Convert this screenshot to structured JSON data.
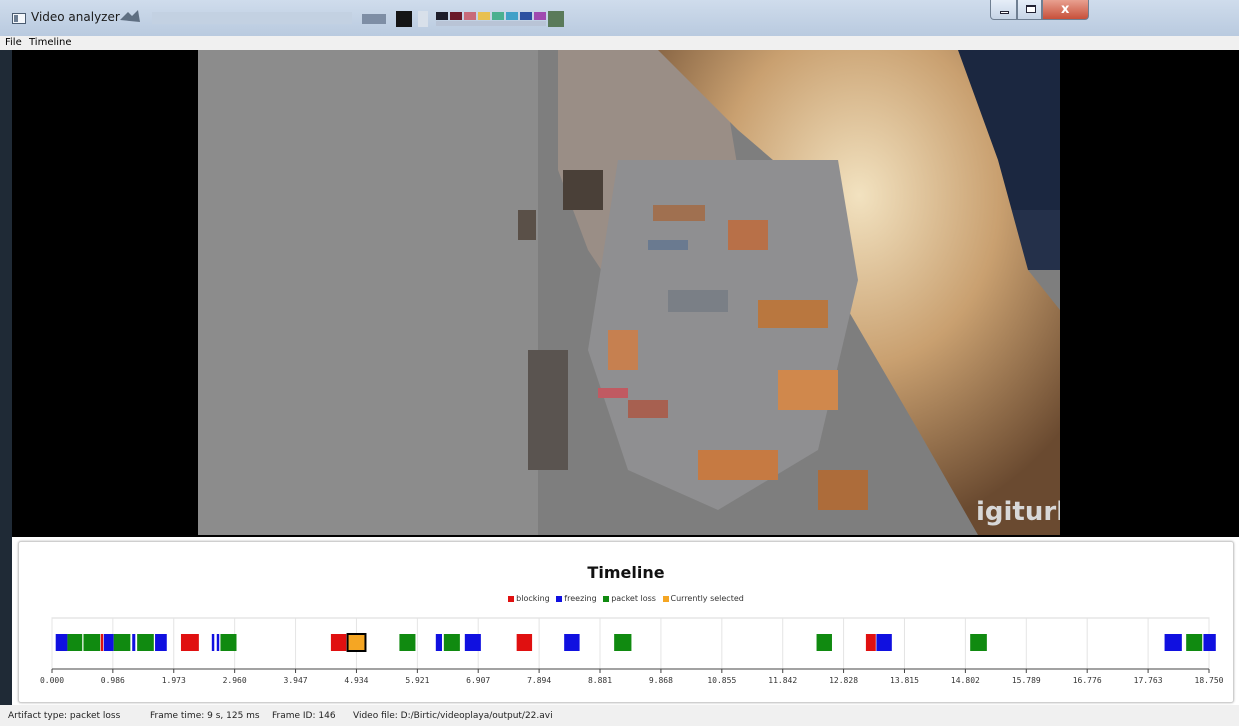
{
  "window": {
    "title": "Video analyzer",
    "buttons": {
      "minimize": "minimize",
      "maximize": "maximize",
      "close": "x"
    }
  },
  "menu": {
    "items": [
      "File",
      "Timeline"
    ]
  },
  "video": {
    "watermark": "igiturk"
  },
  "timeline": {
    "title": "Timeline",
    "legend": [
      {
        "label": "blocking",
        "color": "#e01010"
      },
      {
        "label": "freezing",
        "color": "#1010e0"
      },
      {
        "label": "packet loss",
        "color": "#108a10"
      },
      {
        "label": "Currently selected",
        "color": "#f5a623"
      }
    ],
    "axis": {
      "min": 0,
      "max": 18.75,
      "ticks": [
        "0.000",
        "0.986",
        "1.973",
        "2.960",
        "3.947",
        "4.934",
        "5.921",
        "6.907",
        "7.894",
        "8.881",
        "9.868",
        "10.855",
        "11.842",
        "12.828",
        "13.815",
        "14.802",
        "15.789",
        "16.776",
        "17.763",
        "18.750"
      ]
    },
    "markers": [
      {
        "type": "freezing",
        "start": 0.06,
        "end": 0.25
      },
      {
        "type": "packet loss",
        "start": 0.25,
        "end": 0.49
      },
      {
        "type": "packet loss",
        "start": 0.51,
        "end": 0.78
      },
      {
        "type": "blocking",
        "start": 0.79,
        "end": 0.83
      },
      {
        "type": "freezing",
        "start": 0.84,
        "end": 1.0
      },
      {
        "type": "packet loss",
        "start": 1.0,
        "end": 1.27
      },
      {
        "type": "freezing",
        "start": 1.3,
        "end": 1.35
      },
      {
        "type": "packet loss",
        "start": 1.38,
        "end": 1.65
      },
      {
        "type": "freezing",
        "start": 1.67,
        "end": 1.86
      },
      {
        "type": "blocking",
        "start": 2.09,
        "end": 2.38
      },
      {
        "type": "freezing",
        "start": 2.59,
        "end": 2.63
      },
      {
        "type": "freezing",
        "start": 2.67,
        "end": 2.71
      },
      {
        "type": "packet loss",
        "start": 2.73,
        "end": 2.99
      },
      {
        "type": "blocking",
        "start": 4.52,
        "end": 4.77
      },
      {
        "type": "selected",
        "start": 4.79,
        "end": 5.08
      },
      {
        "type": "packet loss",
        "start": 5.63,
        "end": 5.89
      },
      {
        "type": "freezing",
        "start": 6.22,
        "end": 6.32
      },
      {
        "type": "packet loss",
        "start": 6.35,
        "end": 6.61
      },
      {
        "type": "freezing",
        "start": 6.69,
        "end": 6.95
      },
      {
        "type": "blocking",
        "start": 7.53,
        "end": 7.78
      },
      {
        "type": "freezing",
        "start": 8.3,
        "end": 8.55
      },
      {
        "type": "packet loss",
        "start": 9.11,
        "end": 9.39
      },
      {
        "type": "packet loss",
        "start": 12.39,
        "end": 12.64
      },
      {
        "type": "blocking",
        "start": 13.19,
        "end": 13.35
      },
      {
        "type": "freezing",
        "start": 13.36,
        "end": 13.61
      },
      {
        "type": "packet loss",
        "start": 14.88,
        "end": 15.15
      },
      {
        "type": "freezing",
        "start": 18.03,
        "end": 18.31
      },
      {
        "type": "packet loss",
        "start": 18.38,
        "end": 18.64
      },
      {
        "type": "freezing",
        "start": 18.66,
        "end": 18.86
      }
    ]
  },
  "status": {
    "artifact": "Artifact type: packet loss",
    "frame_time": "Frame time: 9 s, 125 ms",
    "frame_id": "Frame ID: 146",
    "video_file": "Video file: D:/Birtic/videoplaya/output/22.avi"
  }
}
